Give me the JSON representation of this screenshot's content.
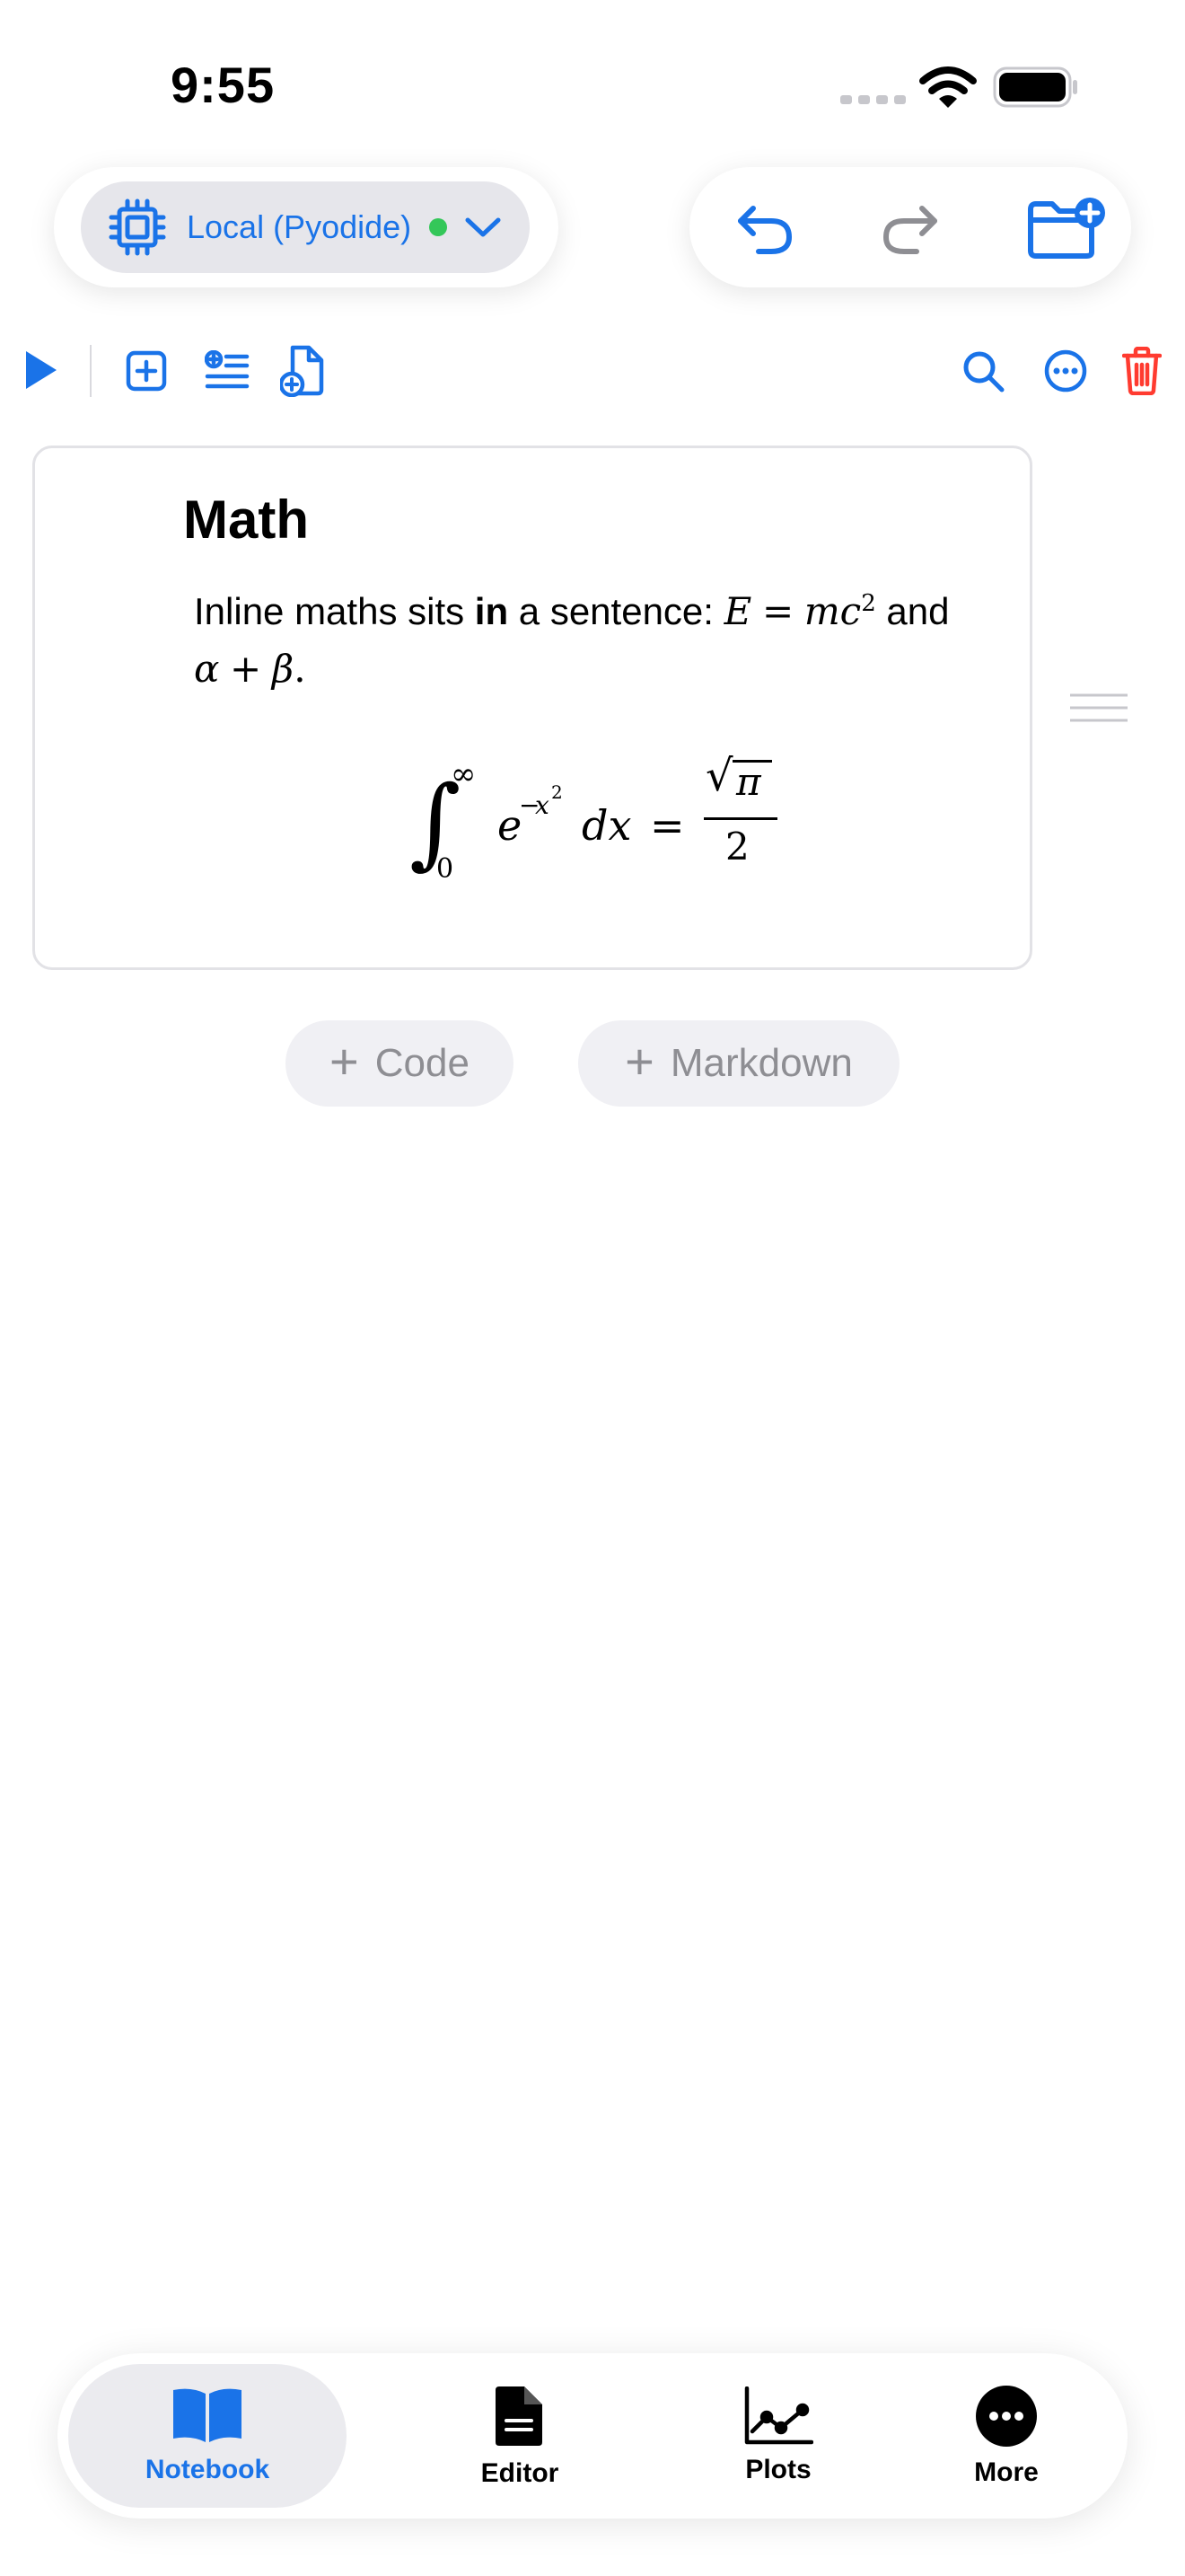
{
  "status": {
    "time": "9:55"
  },
  "kernel": {
    "label": "Local (Pyodide)",
    "status_color": "#34c759",
    "icons": [
      "cpu-chip-icon",
      "chevron-down-icon"
    ]
  },
  "actions": {
    "icons": [
      "undo-icon",
      "redo-icon",
      "folder-add-icon"
    ]
  },
  "toolbar": {
    "icons": [
      "run-icon",
      "add-cell-icon",
      "insert-list-icon",
      "new-document-icon",
      "search-icon",
      "more-circle-icon",
      "trash-icon"
    ]
  },
  "cell": {
    "title": "Math",
    "text_prefix": "Inline maths sits ",
    "text_bold": "in",
    "text_mid": " a sentence: ",
    "eq_e": "E",
    "eq_eq": "=",
    "eq_mc": "mc",
    "eq_sq": "2",
    "text_and": " and",
    "alpha": "α",
    "plus": "+",
    "beta": "β",
    "period": "."
  },
  "formula": {
    "integral": "∫",
    "upper": "∞",
    "lower": "0",
    "base": "e",
    "exp_minus": "−",
    "exp_x": "x",
    "exp_sq": "2",
    "dx": "dx",
    "equals": "=",
    "root": "√",
    "pi": "π",
    "denominator": "2"
  },
  "add_buttons": {
    "plus": "+",
    "code": "Code",
    "markdown": "Markdown"
  },
  "tabs": [
    {
      "label": "Notebook",
      "icon": "book-icon",
      "active": true
    },
    {
      "label": "Editor",
      "icon": "document-icon",
      "active": false
    },
    {
      "label": "Plots",
      "icon": "line-chart-icon",
      "active": false
    },
    {
      "label": "More",
      "icon": "ellipsis-circle-icon",
      "active": false
    }
  ],
  "colors": {
    "accent": "#1a73e8",
    "danger": "#ff3b30",
    "muted": "#8e8e93"
  }
}
